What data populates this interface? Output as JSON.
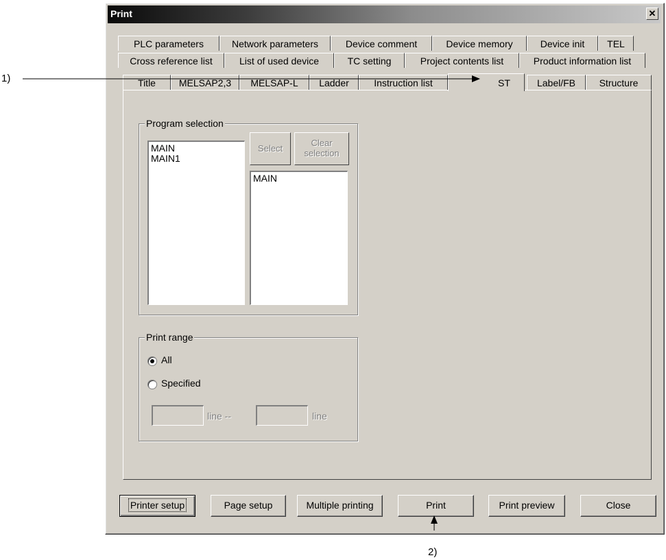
{
  "window": {
    "title": "Print",
    "close_glyph": "✕"
  },
  "tabs": {
    "row1": [
      "PLC parameters",
      "Network parameters",
      "Device comment",
      "Device memory",
      "Device init",
      "TEL"
    ],
    "row2": [
      "Cross reference list",
      "List of used device",
      "TC setting",
      "Project contents list",
      "Product information list"
    ],
    "row3": [
      "Title",
      "MELSAP2,3",
      "MELSAP-L",
      "Ladder",
      "Instruction list",
      "ST",
      "Label/FB",
      "Structure"
    ],
    "active": "ST"
  },
  "program_selection": {
    "legend": "Program selection",
    "available": [
      "MAIN",
      "MAIN1"
    ],
    "select_label": "Select",
    "clear_label_line1": "Clear",
    "clear_label_line2": "selection",
    "selected": [
      "MAIN"
    ]
  },
  "print_range": {
    "legend": "Print range",
    "options": [
      "All",
      "Specified"
    ],
    "selected": "All",
    "line_label_1": "line --",
    "line_label_2": "line"
  },
  "buttons": {
    "printer_setup": "Printer setup",
    "page_setup": "Page setup",
    "multiple_printing": "Multiple printing",
    "print": "Print",
    "print_preview": "Print preview",
    "close": "Close"
  },
  "annotations": {
    "callout_1": "1)",
    "callout_2": "2)"
  }
}
